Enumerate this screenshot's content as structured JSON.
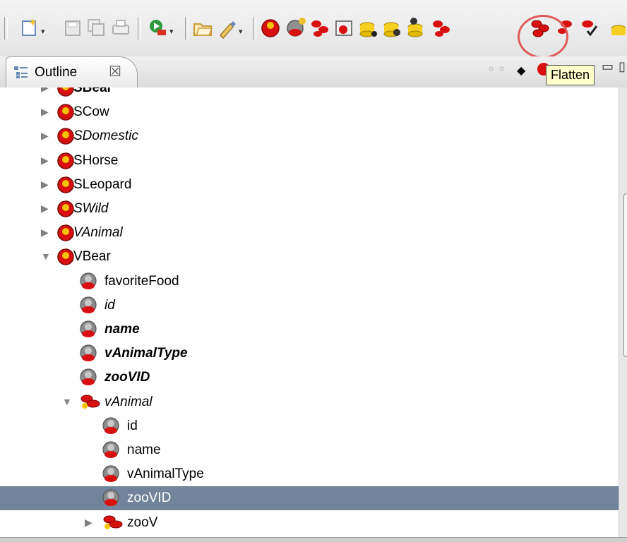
{
  "toolbar": {
    "buttons": [
      {
        "name": "new-wizard-icon"
      },
      {
        "name": "save-icon"
      },
      {
        "name": "save-all-icon"
      },
      {
        "name": "print-icon"
      },
      {
        "name": "run-icon"
      },
      {
        "name": "open-icon"
      },
      {
        "name": "edit-tool-icon"
      },
      {
        "name": "entity-icon"
      },
      {
        "name": "entity-add-icon"
      },
      {
        "name": "relationship-icon"
      },
      {
        "name": "entity-form-icon"
      },
      {
        "name": "database-icon"
      },
      {
        "name": "database-generate-icon"
      },
      {
        "name": "database-add-icon"
      },
      {
        "name": "flatten-icon"
      },
      {
        "name": "inherit-icon"
      },
      {
        "name": "validate-icon"
      }
    ],
    "highlight_color": "#e05a5a"
  },
  "tab": {
    "label": "Outline",
    "close": "☒"
  },
  "tooltip": {
    "text": "Flatten"
  },
  "tree": {
    "rows": [
      {
        "label": "SBear",
        "indent": 0,
        "state": "collapsed",
        "icon": "entity",
        "style": "bold-partial"
      },
      {
        "label": "SCow",
        "indent": 0,
        "state": "collapsed",
        "icon": "entity",
        "style": ""
      },
      {
        "label": "SDomestic",
        "indent": 0,
        "state": "collapsed",
        "icon": "entity",
        "style": "italic"
      },
      {
        "label": "SHorse",
        "indent": 0,
        "state": "collapsed",
        "icon": "entity",
        "style": ""
      },
      {
        "label": "SLeopard",
        "indent": 0,
        "state": "collapsed",
        "icon": "entity",
        "style": ""
      },
      {
        "label": "SWild",
        "indent": 0,
        "state": "collapsed",
        "icon": "entity",
        "style": "italic"
      },
      {
        "label": "VAnimal",
        "indent": 0,
        "state": "collapsed",
        "icon": "entity",
        "style": "italic"
      },
      {
        "label": "VBear",
        "indent": 0,
        "state": "expanded",
        "icon": "entity",
        "style": ""
      },
      {
        "label": "favoriteFood",
        "indent": 1,
        "state": "none",
        "icon": "attribute",
        "style": ""
      },
      {
        "label": "id",
        "indent": 1,
        "state": "none",
        "icon": "attribute",
        "style": "italic"
      },
      {
        "label": "name",
        "indent": 1,
        "state": "none",
        "icon": "attribute",
        "style": "bold italic"
      },
      {
        "label": "vAnimalType",
        "indent": 1,
        "state": "none",
        "icon": "attribute",
        "style": "bold italic"
      },
      {
        "label": "zooVID",
        "indent": 1,
        "state": "none",
        "icon": "attribute",
        "style": "bold italic"
      },
      {
        "label": "vAnimal",
        "indent": 1,
        "state": "expanded",
        "icon": "relationship",
        "style": "italic"
      },
      {
        "label": "id",
        "indent": 2,
        "state": "none",
        "icon": "attribute",
        "style": ""
      },
      {
        "label": "name",
        "indent": 2,
        "state": "none",
        "icon": "attribute",
        "style": ""
      },
      {
        "label": "vAnimalType",
        "indent": 2,
        "state": "none",
        "icon": "attribute",
        "style": ""
      },
      {
        "label": "zooVID",
        "indent": 2,
        "state": "none",
        "icon": "attribute",
        "style": "",
        "selected": true
      },
      {
        "label": "zooV",
        "indent": 2,
        "state": "collapsed",
        "icon": "relationship",
        "style": ""
      }
    ]
  },
  "colors": {
    "selection": "#73839c",
    "entity_red": "#d81010",
    "entity_yellow": "#f5c400"
  }
}
